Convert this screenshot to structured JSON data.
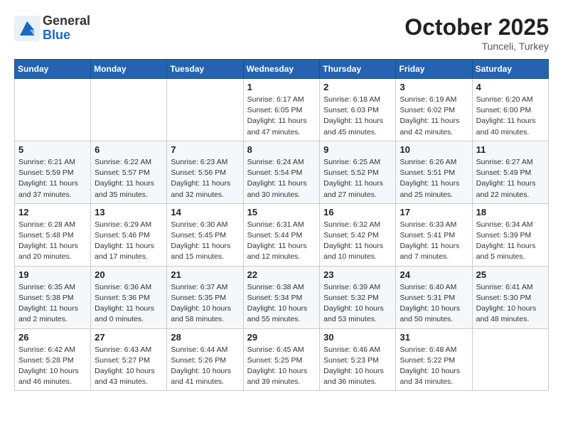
{
  "logo": {
    "general": "General",
    "blue": "Blue"
  },
  "title": {
    "month": "October 2025",
    "location": "Tunceli, Turkey"
  },
  "weekdays": [
    "Sunday",
    "Monday",
    "Tuesday",
    "Wednesday",
    "Thursday",
    "Friday",
    "Saturday"
  ],
  "weeks": [
    [
      {
        "day": "",
        "info": ""
      },
      {
        "day": "",
        "info": ""
      },
      {
        "day": "",
        "info": ""
      },
      {
        "day": "1",
        "info": "Sunrise: 6:17 AM\nSunset: 6:05 PM\nDaylight: 11 hours\nand 47 minutes."
      },
      {
        "day": "2",
        "info": "Sunrise: 6:18 AM\nSunset: 6:03 PM\nDaylight: 11 hours\nand 45 minutes."
      },
      {
        "day": "3",
        "info": "Sunrise: 6:19 AM\nSunset: 6:02 PM\nDaylight: 11 hours\nand 42 minutes."
      },
      {
        "day": "4",
        "info": "Sunrise: 6:20 AM\nSunset: 6:00 PM\nDaylight: 11 hours\nand 40 minutes."
      }
    ],
    [
      {
        "day": "5",
        "info": "Sunrise: 6:21 AM\nSunset: 5:59 PM\nDaylight: 11 hours\nand 37 minutes."
      },
      {
        "day": "6",
        "info": "Sunrise: 6:22 AM\nSunset: 5:57 PM\nDaylight: 11 hours\nand 35 minutes."
      },
      {
        "day": "7",
        "info": "Sunrise: 6:23 AM\nSunset: 5:56 PM\nDaylight: 11 hours\nand 32 minutes."
      },
      {
        "day": "8",
        "info": "Sunrise: 6:24 AM\nSunset: 5:54 PM\nDaylight: 11 hours\nand 30 minutes."
      },
      {
        "day": "9",
        "info": "Sunrise: 6:25 AM\nSunset: 5:52 PM\nDaylight: 11 hours\nand 27 minutes."
      },
      {
        "day": "10",
        "info": "Sunrise: 6:26 AM\nSunset: 5:51 PM\nDaylight: 11 hours\nand 25 minutes."
      },
      {
        "day": "11",
        "info": "Sunrise: 6:27 AM\nSunset: 5:49 PM\nDaylight: 11 hours\nand 22 minutes."
      }
    ],
    [
      {
        "day": "12",
        "info": "Sunrise: 6:28 AM\nSunset: 5:48 PM\nDaylight: 11 hours\nand 20 minutes."
      },
      {
        "day": "13",
        "info": "Sunrise: 6:29 AM\nSunset: 5:46 PM\nDaylight: 11 hours\nand 17 minutes."
      },
      {
        "day": "14",
        "info": "Sunrise: 6:30 AM\nSunset: 5:45 PM\nDaylight: 11 hours\nand 15 minutes."
      },
      {
        "day": "15",
        "info": "Sunrise: 6:31 AM\nSunset: 5:44 PM\nDaylight: 11 hours\nand 12 minutes."
      },
      {
        "day": "16",
        "info": "Sunrise: 6:32 AM\nSunset: 5:42 PM\nDaylight: 11 hours\nand 10 minutes."
      },
      {
        "day": "17",
        "info": "Sunrise: 6:33 AM\nSunset: 5:41 PM\nDaylight: 11 hours\nand 7 minutes."
      },
      {
        "day": "18",
        "info": "Sunrise: 6:34 AM\nSunset: 5:39 PM\nDaylight: 11 hours\nand 5 minutes."
      }
    ],
    [
      {
        "day": "19",
        "info": "Sunrise: 6:35 AM\nSunset: 5:38 PM\nDaylight: 11 hours\nand 2 minutes."
      },
      {
        "day": "20",
        "info": "Sunrise: 6:36 AM\nSunset: 5:36 PM\nDaylight: 11 hours\nand 0 minutes."
      },
      {
        "day": "21",
        "info": "Sunrise: 6:37 AM\nSunset: 5:35 PM\nDaylight: 10 hours\nand 58 minutes."
      },
      {
        "day": "22",
        "info": "Sunrise: 6:38 AM\nSunset: 5:34 PM\nDaylight: 10 hours\nand 55 minutes."
      },
      {
        "day": "23",
        "info": "Sunrise: 6:39 AM\nSunset: 5:32 PM\nDaylight: 10 hours\nand 53 minutes."
      },
      {
        "day": "24",
        "info": "Sunrise: 6:40 AM\nSunset: 5:31 PM\nDaylight: 10 hours\nand 50 minutes."
      },
      {
        "day": "25",
        "info": "Sunrise: 6:41 AM\nSunset: 5:30 PM\nDaylight: 10 hours\nand 48 minutes."
      }
    ],
    [
      {
        "day": "26",
        "info": "Sunrise: 6:42 AM\nSunset: 5:28 PM\nDaylight: 10 hours\nand 46 minutes."
      },
      {
        "day": "27",
        "info": "Sunrise: 6:43 AM\nSunset: 5:27 PM\nDaylight: 10 hours\nand 43 minutes."
      },
      {
        "day": "28",
        "info": "Sunrise: 6:44 AM\nSunset: 5:26 PM\nDaylight: 10 hours\nand 41 minutes."
      },
      {
        "day": "29",
        "info": "Sunrise: 6:45 AM\nSunset: 5:25 PM\nDaylight: 10 hours\nand 39 minutes."
      },
      {
        "day": "30",
        "info": "Sunrise: 6:46 AM\nSunset: 5:23 PM\nDaylight: 10 hours\nand 36 minutes."
      },
      {
        "day": "31",
        "info": "Sunrise: 6:48 AM\nSunset: 5:22 PM\nDaylight: 10 hours\nand 34 minutes."
      },
      {
        "day": "",
        "info": ""
      }
    ]
  ]
}
